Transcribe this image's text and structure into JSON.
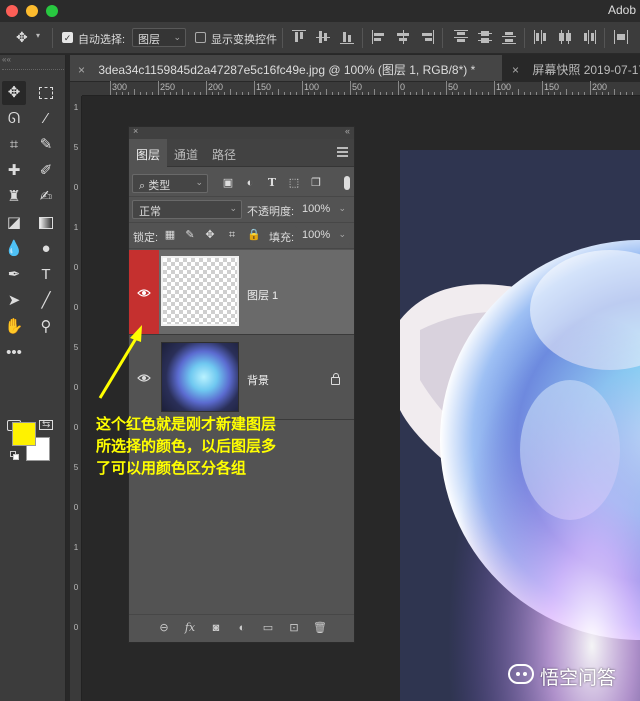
{
  "window": {
    "app_title": "Adob"
  },
  "options_bar": {
    "auto_select_label": "自动选择:",
    "auto_select_value": "图层",
    "show_transform_label": "显示变换控件"
  },
  "tabs": [
    {
      "label": "3dea34c1159845d2a47287e5c16fc49e.jpg @ 100% (图层 1, RGB/8*) *",
      "close": "×"
    },
    {
      "label": "屏幕快照 2019-07-17",
      "close": "×"
    }
  ],
  "ruler": {
    "h_labels": [
      "300",
      "250",
      "200",
      "150",
      "100",
      "50",
      "0",
      "50",
      "100",
      "150",
      "200"
    ],
    "v_labels": [
      "1",
      "5",
      "0",
      "1",
      "0",
      "0",
      "5",
      "0",
      "0",
      "5",
      "0",
      "1",
      "0",
      "0"
    ]
  },
  "colors": {
    "foreground": "#fff200",
    "background": "#ffffff",
    "layer_label_red": "#c5302f",
    "annotation": "#ffff00"
  },
  "layers_panel": {
    "tabs": [
      "图层",
      "通道",
      "路径"
    ],
    "filter_kind": "类型",
    "blend_mode": "正常",
    "opacity_label": "不透明度:",
    "opacity_value": "100%",
    "lock_label": "锁定:",
    "fill_label": "填充:",
    "fill_value": "100%",
    "layers": [
      {
        "name": "图层 1",
        "selected": true,
        "color_label": "red",
        "visible": true
      },
      {
        "name": "背景",
        "selected": false,
        "locked": true,
        "visible": true
      }
    ],
    "bottom_icons": [
      "link-icon",
      "fx-icon",
      "mask-icon",
      "adjustment-icon",
      "folder-icon",
      "new-layer-icon",
      "trash-icon"
    ]
  },
  "annotation": {
    "lines": [
      "这个红色就是刚才新建图层",
      "所选择的颜色，以后图层多",
      "了可以用颜色区分各组"
    ]
  },
  "watermark": {
    "text": "悟空问答"
  }
}
